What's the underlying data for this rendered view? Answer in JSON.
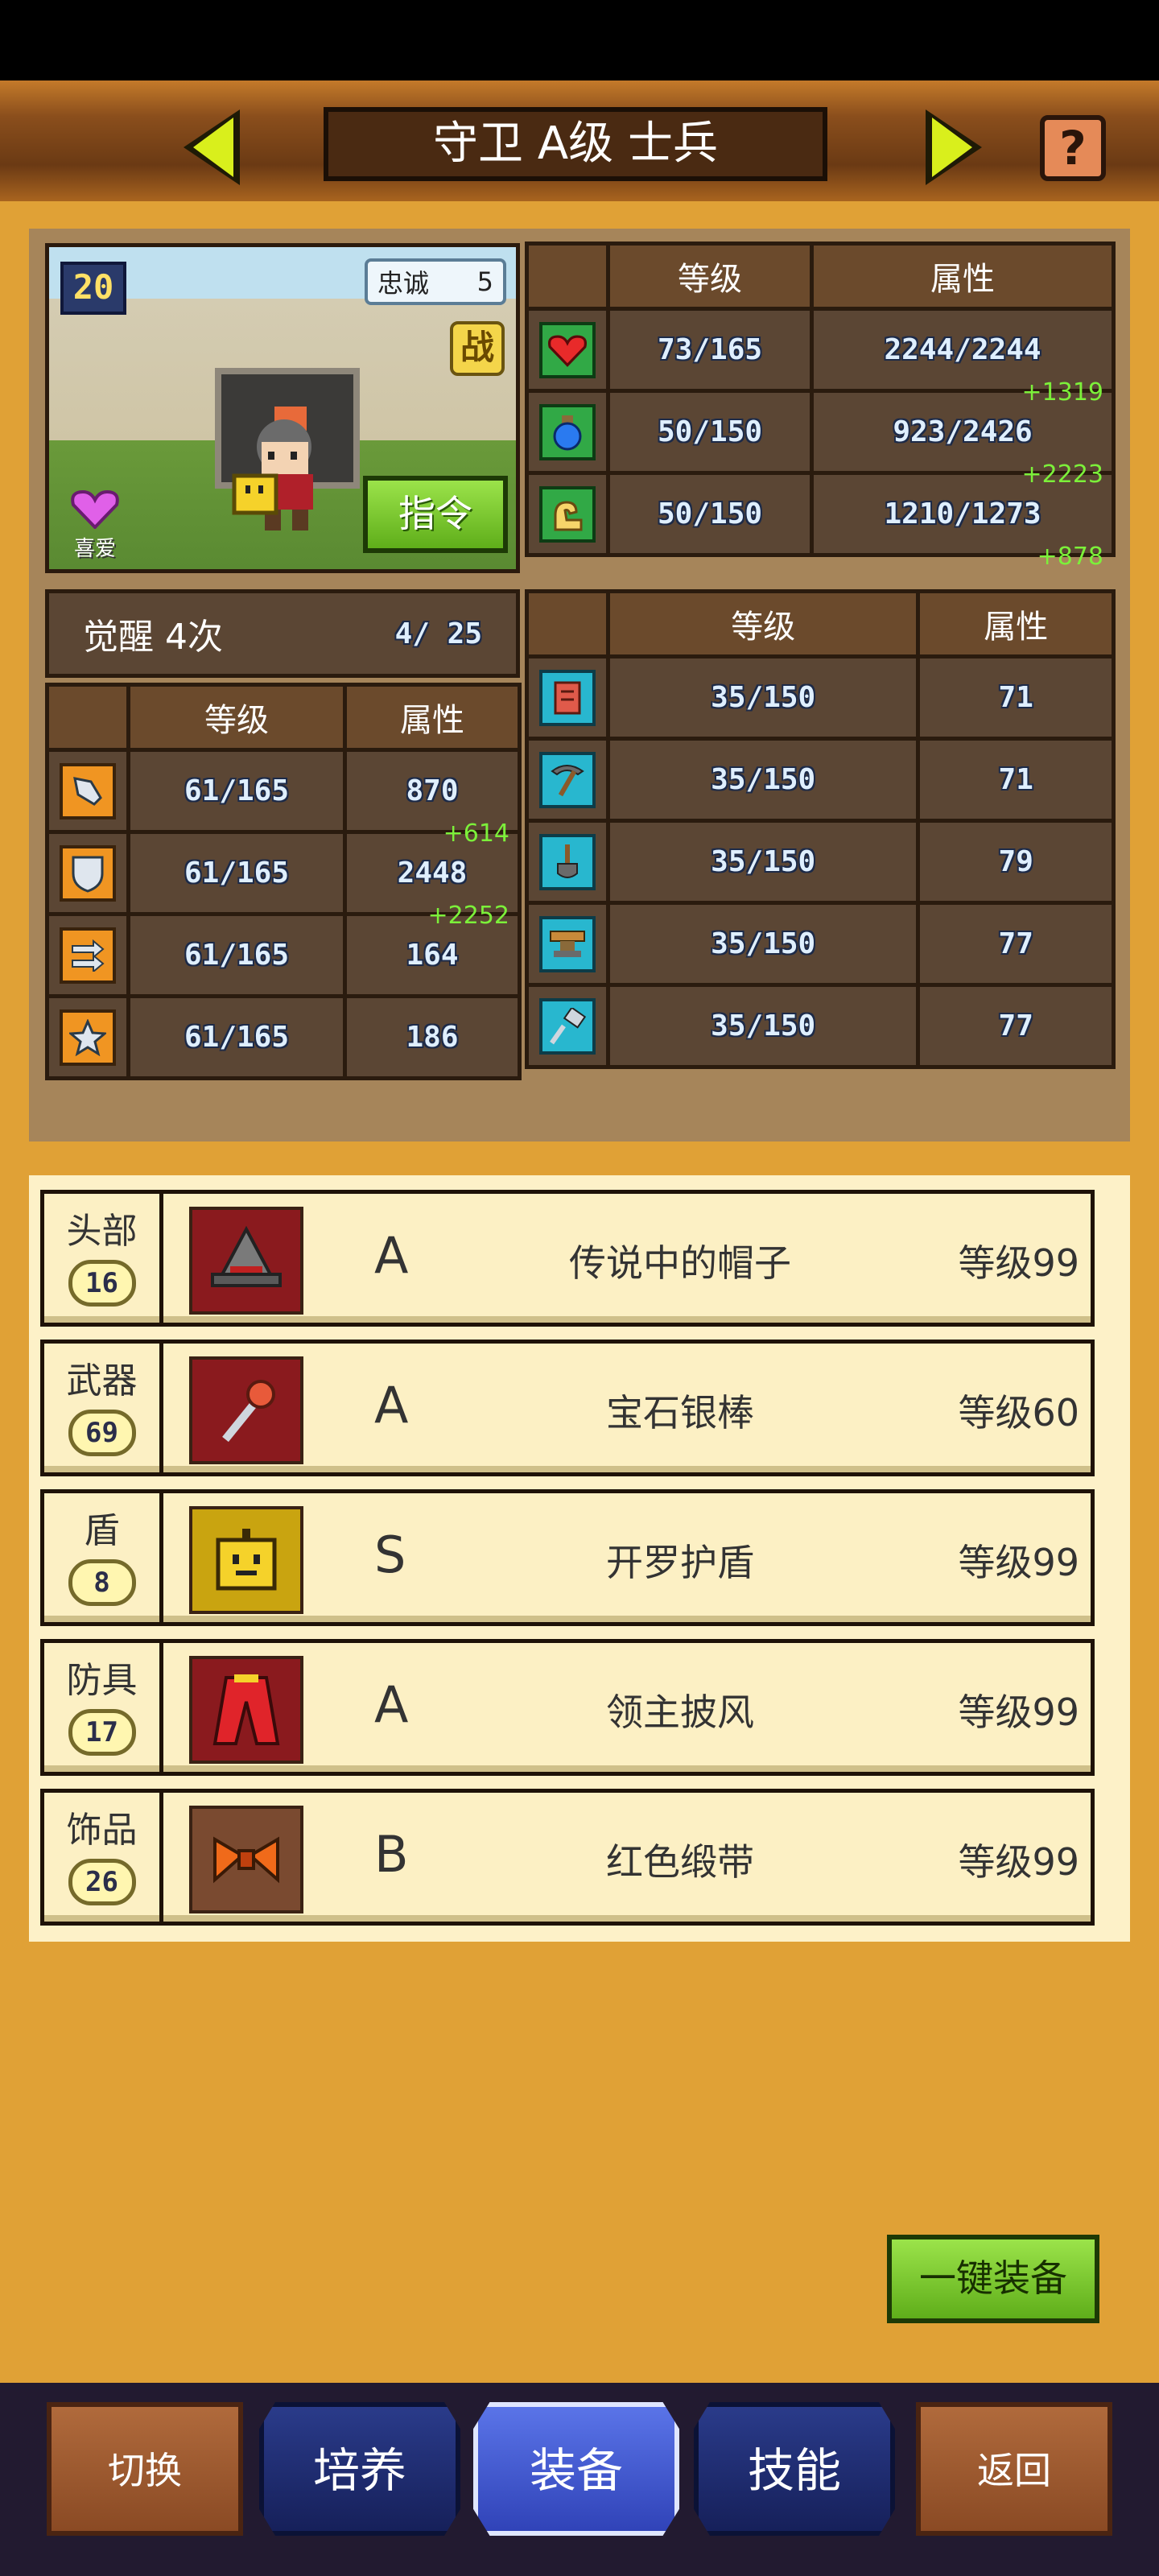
{
  "header": {
    "title": "守卫 A级 士兵",
    "help_label": "?"
  },
  "portrait": {
    "level": "20",
    "loyalty_label": "忠诚",
    "loyalty_value": "5",
    "battle_label": "战",
    "command_label": "指令",
    "favorite_label": "喜爱"
  },
  "main_stats": {
    "col_level": "等级",
    "col_attr": "属性",
    "rows": [
      {
        "icon": "heart-icon",
        "level": "73/165",
        "attr": "2244/2244",
        "bonus": "+1319"
      },
      {
        "icon": "potion-icon",
        "level": "50/150",
        "attr": "923/2426",
        "bonus": "+2223"
      },
      {
        "icon": "arm-icon",
        "level": "50/150",
        "attr": "1210/1273",
        "bonus": "+878"
      }
    ]
  },
  "awaken": {
    "label": "觉醒 4次",
    "count": "4/ 25"
  },
  "combat_stats": {
    "col_level": "等级",
    "col_attr": "属性",
    "rows": [
      {
        "icon": "sword-icon",
        "level": "61/165",
        "attr": "870",
        "bonus": "+614"
      },
      {
        "icon": "shield-icon",
        "level": "61/165",
        "attr": "2448",
        "bonus": "+2252"
      },
      {
        "icon": "speed-arrows-icon",
        "level": "61/165",
        "attr": "164",
        "bonus": ""
      },
      {
        "icon": "star-icon",
        "level": "61/165",
        "attr": "186",
        "bonus": ""
      }
    ]
  },
  "craft_stats": {
    "col_level": "等级",
    "col_attr": "属性",
    "rows": [
      {
        "icon": "book-icon",
        "level": "35/150",
        "attr": "71"
      },
      {
        "icon": "pickaxe-icon",
        "level": "35/150",
        "attr": "71"
      },
      {
        "icon": "shovel-icon",
        "level": "35/150",
        "attr": "79"
      },
      {
        "icon": "anvil-icon",
        "level": "35/150",
        "attr": "77"
      },
      {
        "icon": "hammer-icon",
        "level": "35/150",
        "attr": "77"
      }
    ]
  },
  "equipment": [
    {
      "slot": "头部",
      "badge": "16",
      "rank": "A",
      "name": "传说中的帽子",
      "level": "等级99",
      "icon": "wizard-hat-icon",
      "bg": "#8a1a1e"
    },
    {
      "slot": "武器",
      "badge": "69",
      "rank": "A",
      "name": "宝石银棒",
      "level": "等级60",
      "icon": "gem-staff-icon",
      "bg": "#8a1a1e"
    },
    {
      "slot": "盾",
      "badge": "8",
      "rank": "S",
      "name": "开罗护盾",
      "level": "等级99",
      "icon": "kairo-shield-icon",
      "bg": "#c9a410"
    },
    {
      "slot": "防具",
      "badge": "17",
      "rank": "A",
      "name": "领主披风",
      "level": "等级99",
      "icon": "cape-icon",
      "bg": "#8a1a1e"
    },
    {
      "slot": "饰品",
      "badge": "26",
      "rank": "B",
      "name": "红色缎带",
      "level": "等级99",
      "icon": "ribbon-icon",
      "bg": "#7a4a30"
    }
  ],
  "one_key_label": "一键装备",
  "nav": {
    "switch": "切换",
    "train": "培养",
    "equip": "装备",
    "skill": "技能",
    "back": "返回"
  }
}
